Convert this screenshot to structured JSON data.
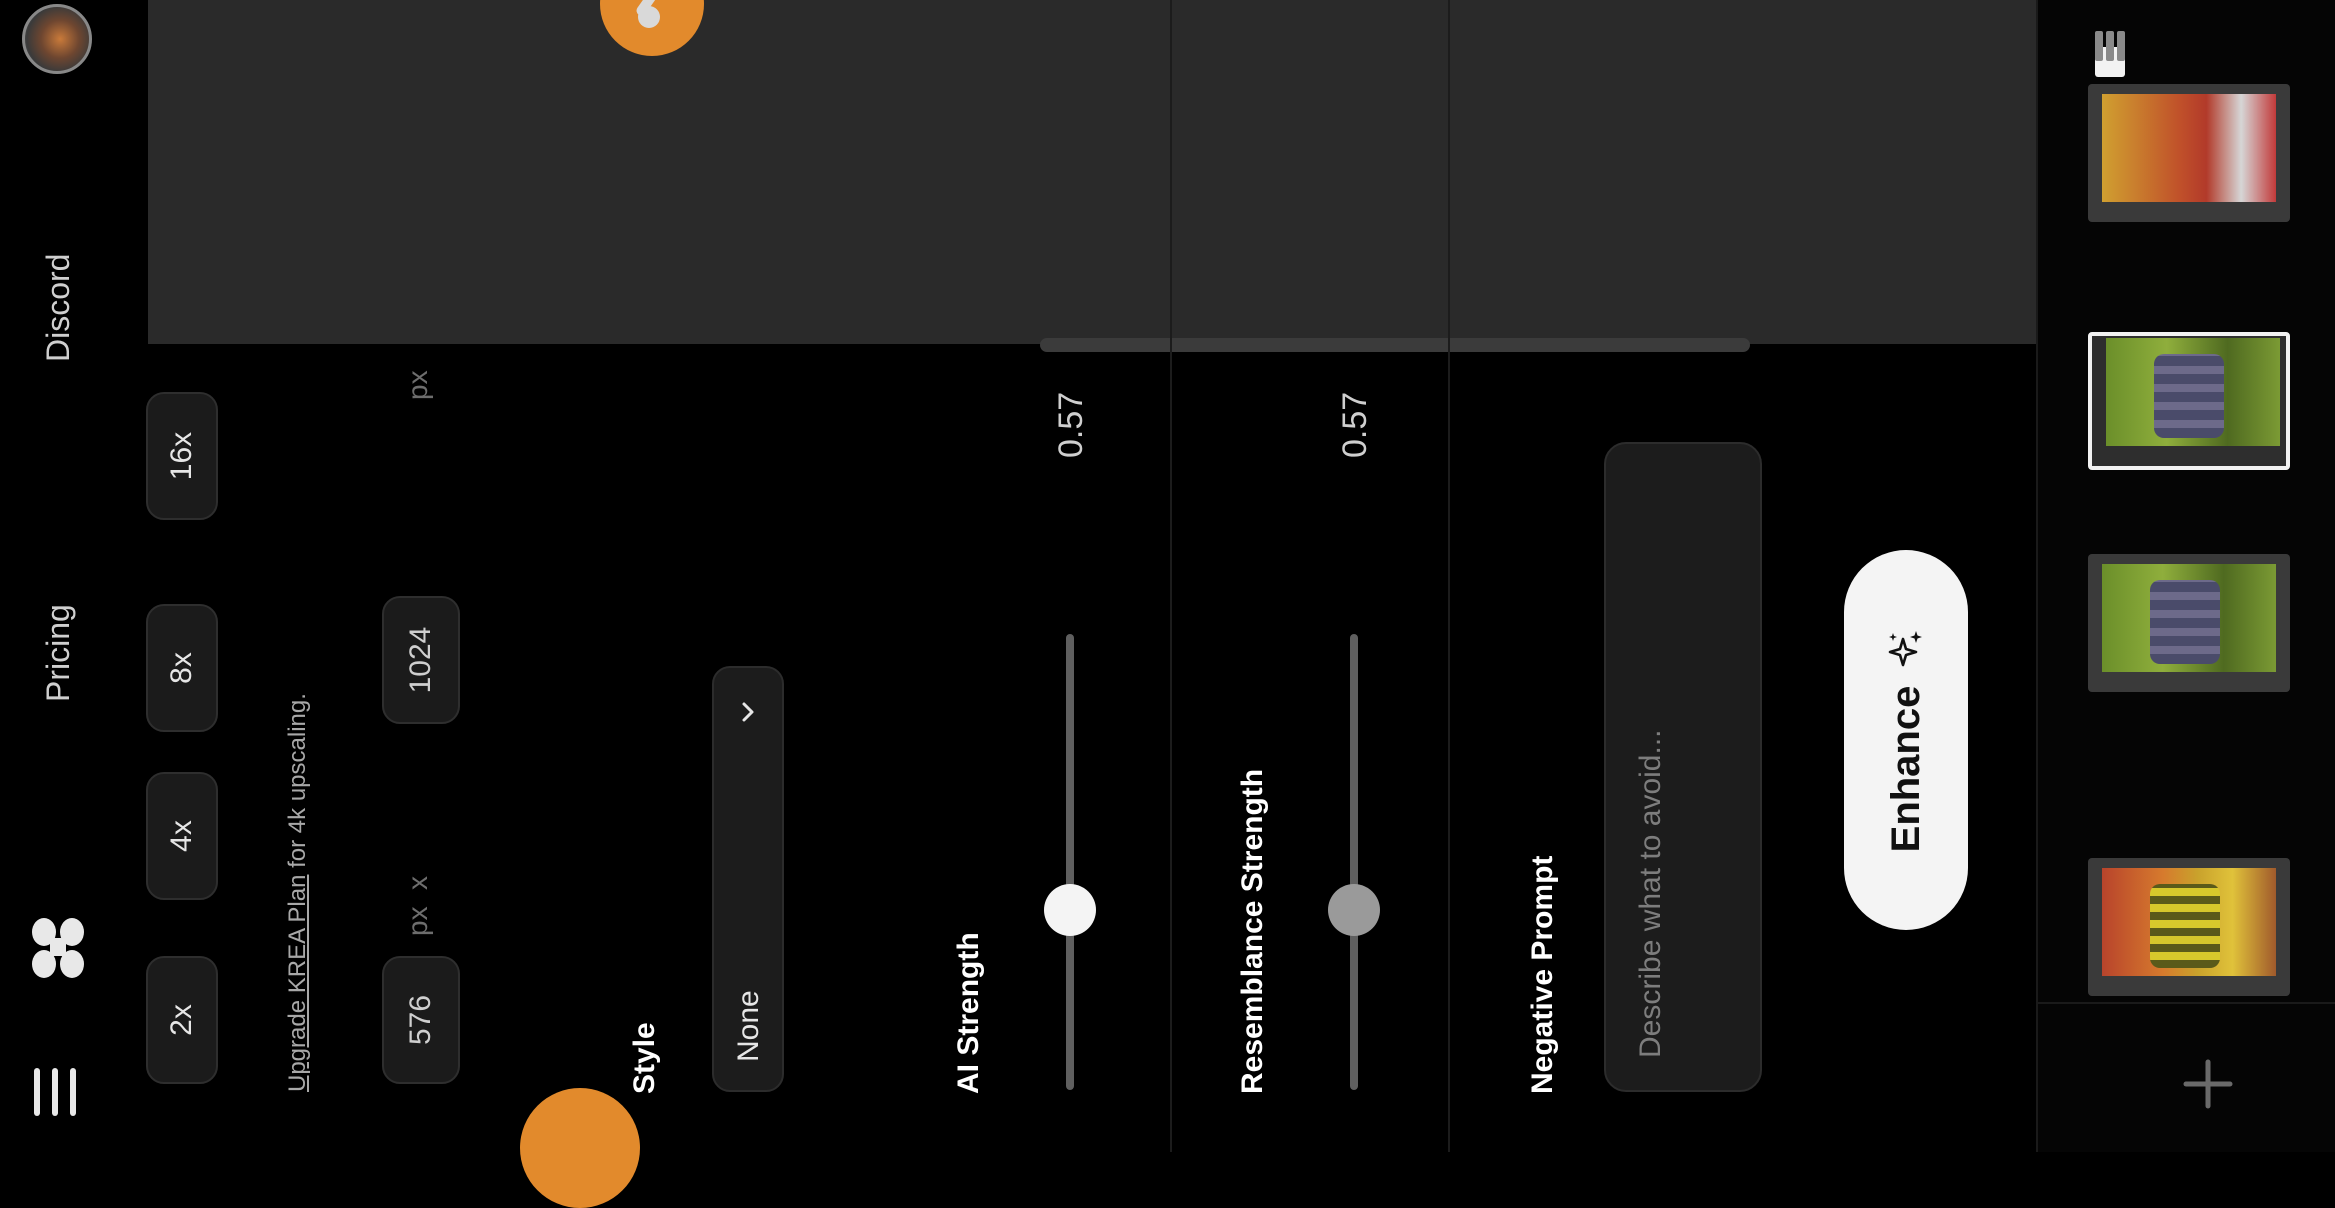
{
  "nav": {
    "pricing_label": "Pricing",
    "discord_label": "Discord",
    "logo_icon": "krea-logo-icon",
    "menu_icon": "hamburger-menu-icon"
  },
  "upscale": {
    "options": [
      "2x",
      "4x",
      "8x",
      "16x"
    ],
    "upgrade_link": "Upgrade KREA Plan",
    "upgrade_suffix": " for 4k upscaling."
  },
  "dimensions": {
    "width": "576",
    "height": "1024",
    "unit": "px",
    "separator": "x"
  },
  "style": {
    "label": "Style",
    "value": "None"
  },
  "ai_strength": {
    "label": "AI Strength",
    "value": "0.57",
    "fraction": 0.57
  },
  "resemblance_strength": {
    "label": "Resemblance Strength",
    "value": "0.57",
    "fraction": 0.57
  },
  "negative_prompt": {
    "label": "Negative Prompt",
    "placeholder": "Describe what to avoid..."
  },
  "enhance": {
    "label": "Enhance",
    "icon": "sparkle-icon"
  },
  "history": {
    "icons": [
      "layout-single-icon",
      "layout-split-icon",
      "layout-stack-icon",
      "plus-icon"
    ]
  },
  "colors": {
    "accent_orange": "#e28a2c",
    "background": "#000000",
    "canvas": "#2a2a2a",
    "button_light": "#f4f4f4"
  }
}
